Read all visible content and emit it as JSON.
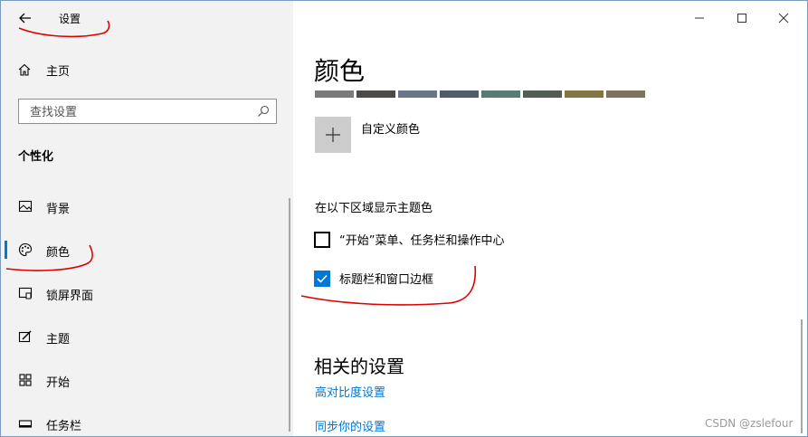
{
  "window": {
    "title": "设置",
    "controls": {
      "minimize": "minimize-icon",
      "maximize": "maximize-icon",
      "close": "close-icon"
    }
  },
  "sidebar": {
    "home_label": "主页",
    "search_placeholder": "查找设置",
    "section_title": "个性化",
    "items": [
      {
        "label": "背景",
        "icon": "image-icon"
      },
      {
        "label": "颜色",
        "icon": "palette-icon",
        "selected": true
      },
      {
        "label": "锁屏界面",
        "icon": "lock-screen-icon"
      },
      {
        "label": "主题",
        "icon": "theme-icon"
      },
      {
        "label": "开始",
        "icon": "start-icon"
      },
      {
        "label": "任务栏",
        "icon": "taskbar-icon"
      }
    ]
  },
  "main": {
    "heading": "颜色",
    "recent_colors": [
      "#7a7a7a",
      "#4c4a48",
      "#68768a",
      "#515c6b",
      "#567c73",
      "#525e54",
      "#847545",
      "#7e735f"
    ],
    "custom_color_label": "自定义颜色",
    "accent_surfaces_title": "在以下区域显示主题色",
    "checkboxes": [
      {
        "label": "“开始”菜单、任务栏和操作中心",
        "checked": false
      },
      {
        "label": "标题栏和窗口边框",
        "checked": true
      }
    ],
    "related_title": "相关的设置",
    "related_links": [
      "高对比度设置",
      "同步你的设置"
    ]
  },
  "accent_color": "#0078d7",
  "watermark": "CSDN @zslefour"
}
